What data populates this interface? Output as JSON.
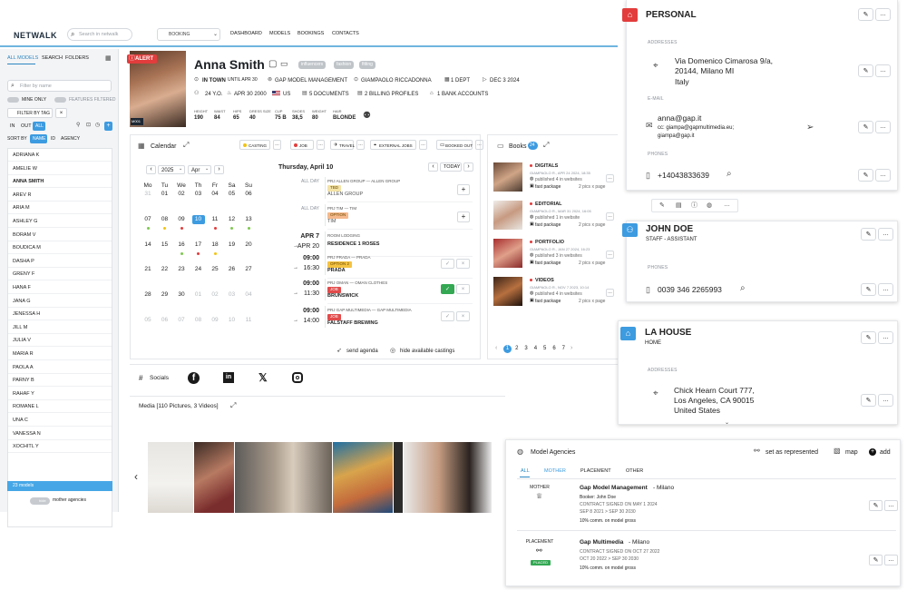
{
  "brand": {
    "name": "NETWALK"
  },
  "topnav": {
    "search_placeholder": "Search in netwalk",
    "booking_select": "BOOKING",
    "items": [
      "DASHBOARD",
      "MODELS",
      "BOOKINGS",
      "CONTACTS"
    ]
  },
  "left": {
    "tabs": [
      "ALL MODELS",
      "SEARCH",
      "FOLDERS"
    ],
    "filter_placeholder": "Filter by name",
    "toggle1": "MINE ONLY",
    "toggle2": "FEATURES FILTERED",
    "filter_tag": "FILTER BY TAG",
    "in_out": [
      "IN",
      "OUT",
      "ALL"
    ],
    "sort_by": "SORT BY",
    "sort": [
      "NAME",
      "ID",
      "AGENCY"
    ],
    "models": [
      "ADRIANA K",
      "AMELIE W",
      "ANNA SMITH",
      "AREV R",
      "ARIA M",
      "ASHLEY G",
      "BORAM V",
      "BOUDICA M",
      "DASHA P",
      "GRENY F",
      "HANA F",
      "JANA G",
      "JENESSA H",
      "JILL M",
      "JULIA V",
      "MARIA R",
      "PAOLA A",
      "PARNY B",
      "RAHAF Y",
      "ROMANE L",
      "UNA C",
      "VANESSA N",
      "XOCHITL Y"
    ],
    "count": "23 models",
    "mother_toggle": "mother agencies"
  },
  "profile": {
    "alert": "ALERT",
    "id": "M001",
    "name": "Anna Smith",
    "tags": [
      "influencers",
      "fashion",
      "fitting"
    ],
    "in_town": "IN TOWN",
    "until": "UNTIL APR 30",
    "agency": "GAP MODEL MANAGEMENT",
    "booker": "GIAMPAOLO RICCADONNA",
    "dept": "1 DEPT",
    "date": "DEC 3 2024",
    "age": "24 Y.O.",
    "dob": "APR 30 2000",
    "country": "US",
    "docs": "5 DOCUMENTS",
    "billing": "2 BILLING PROFILES",
    "bank": "1 BANK ACCOUNTS",
    "measures": [
      {
        "k": "HEIGHT",
        "v": "190"
      },
      {
        "k": "WAIST",
        "v": "84"
      },
      {
        "k": "HIPS",
        "v": "65"
      },
      {
        "k": "DRESS SIZE",
        "v": "40"
      },
      {
        "k": "CUP",
        "v": "75 B"
      },
      {
        "k": "SHOES",
        "v": "38,5"
      },
      {
        "k": "WEIGHT",
        "v": "80"
      },
      {
        "k": "HAIR",
        "v": "BLONDE"
      }
    ]
  },
  "calendar": {
    "title": "Calendar",
    "filters": [
      "CASTING",
      "JOB",
      "TRAVEL",
      "EXTERNAL JOBS",
      "BOOKED OUT"
    ],
    "year": "2025",
    "month": "Apr",
    "dow": [
      "Mo",
      "Tu",
      "We",
      "Th",
      "Fr",
      "Sa",
      "Su"
    ],
    "weeks": [
      [
        "31",
        "01",
        "02",
        "03",
        "04",
        "05",
        "06"
      ],
      [
        "07",
        "08",
        "09",
        "10",
        "11",
        "12",
        "13"
      ],
      [
        "14",
        "15",
        "16",
        "17",
        "18",
        "19",
        "20"
      ],
      [
        "21",
        "22",
        "23",
        "24",
        "25",
        "26",
        "27"
      ],
      [
        "28",
        "29",
        "30",
        "01",
        "02",
        "03",
        "04"
      ],
      [
        "05",
        "06",
        "07",
        "08",
        "09",
        "10",
        "11"
      ]
    ],
    "day_title": "Thursday, April 10",
    "today": "TODAY",
    "send_agenda": "send agenda",
    "hide_castings": "hide available castings",
    "events": [
      {
        "t1": "ALL DAY",
        "t2": "",
        "l1": "PRJ ALLEN GROUP — ALLEN GROUP",
        "tag": "TBD",
        "tagc": "#f3e3a6",
        "l2": "ALLEN GROUP",
        "bold": false
      },
      {
        "t1": "ALL DAY",
        "t2": "",
        "l1": "PRJ TIM — TIM",
        "tag": "OPTION",
        "tagc": "#f5b98c",
        "l2": "TIM",
        "bold": false
      },
      {
        "t1": "APR 7",
        "t2": "APR 20",
        "l1": "ROOM LODGING",
        "tag": "",
        "tagc": "",
        "l2": "RESIDENCE 1 ROSES",
        "bold": true
      },
      {
        "t1": "09:00",
        "t2": "16:30",
        "l1": "PRJ PRADA — PRADA",
        "tag": "OPTION 2",
        "tagc": "#f5c342",
        "l2": "PRADA",
        "bold": true
      },
      {
        "t1": "09:00",
        "t2": "11:30",
        "l1": "PRJ OMAN — OMAN CLOTHES",
        "tag": "JOB",
        "tagc": "#e24b4b",
        "l2": "BRUNSWICK",
        "bold": true
      },
      {
        "t1": "09:00",
        "t2": "14:00",
        "l1": "PRJ GAP MULTIMEDIA — GAP MULTIMEDIA",
        "tag": "JOB",
        "tagc": "#e24b4b",
        "l2": "FALSTAFF BREWING",
        "bold": true
      }
    ]
  },
  "books": {
    "title": "Books",
    "count": "24",
    "items": [
      {
        "name": "DIGITALS",
        "meta": "GIAMPAOLO R., APR 24 2024, 18:35",
        "pub": "published 4 in websites",
        "pkg": "fast package",
        "pics": "2 pics x page"
      },
      {
        "name": "EDITORIAL",
        "meta": "GIAMPAOLO R., MAR 31 2024, 16:05",
        "pub": "published 1 in website",
        "pkg": "fast package",
        "pics": "2 pics x page"
      },
      {
        "name": "PORTFOLIO",
        "meta": "GIAMPAOLO R., JAN 27 2024, 16:23",
        "pub": "published 3 in websites",
        "pkg": "fast package",
        "pics": "2 pics x page"
      },
      {
        "name": "VIDEOS",
        "meta": "GIAMPAOLO R., NOV 7 2023, 10:14",
        "pub": "published 4 in websites",
        "pkg": "fast package",
        "pics": "2 pics x page"
      }
    ],
    "pages": [
      "1",
      "2",
      "3",
      "4",
      "5",
      "6",
      "7"
    ]
  },
  "socials": {
    "title": "Socials"
  },
  "media": {
    "title": "Media [110 Pictures, 3 Videos]"
  },
  "personal": {
    "title": "PERSONAL",
    "addresses": "ADDRESSES",
    "addr": [
      "Via Domenico Cimarosa 9/a,",
      "20144, Milano MI",
      "Italy"
    ],
    "email_lbl": "E-MAIL",
    "email": "anna@gap.it",
    "cc": "cc: giampa@gapmultimedia.eu;",
    "cc2": "giampa@gap.it",
    "phones": "PHONES",
    "phone": "+14043833639"
  },
  "john": {
    "title": "JOHN DOE",
    "sub": "STAFF - ASSISTANT",
    "phones": "PHONES",
    "phone": "0039 346 2265993"
  },
  "lahouse": {
    "title": "LA HOUSE",
    "sub": "HOME",
    "addresses": "ADDRESSES",
    "addr": [
      "Chick Hearn Court 777,",
      "Los Angeles, CA 90015",
      "United States"
    ]
  },
  "agencies": {
    "title": "Model Agencies",
    "set_rep": "set as represented",
    "map": "map",
    "add": "add",
    "tabs": [
      "ALL",
      "MOTHER",
      "PLACEMENT",
      "OTHER"
    ],
    "items": [
      {
        "type": "MOTHER",
        "name": "Gap Model Management",
        "city": " - Milano",
        "l1": "Booker: John Doe",
        "l2": "CONTRACT SIGNED ON MAY 1 2024",
        "l3": "SEP 8 2021 > SEP 30 2030",
        "l4": "10% comm. on model gross",
        "badge": ""
      },
      {
        "type": "PLACEMENT",
        "name": "Gap Multimedia",
        "city": " - Milano",
        "l1": "",
        "l2": "CONTRACT SIGNED ON OCT 27 2022",
        "l3": "OCT 20 2022 > SEP 30 2030",
        "l4": "10% comm. on model gross",
        "badge": "PLACED"
      }
    ]
  }
}
